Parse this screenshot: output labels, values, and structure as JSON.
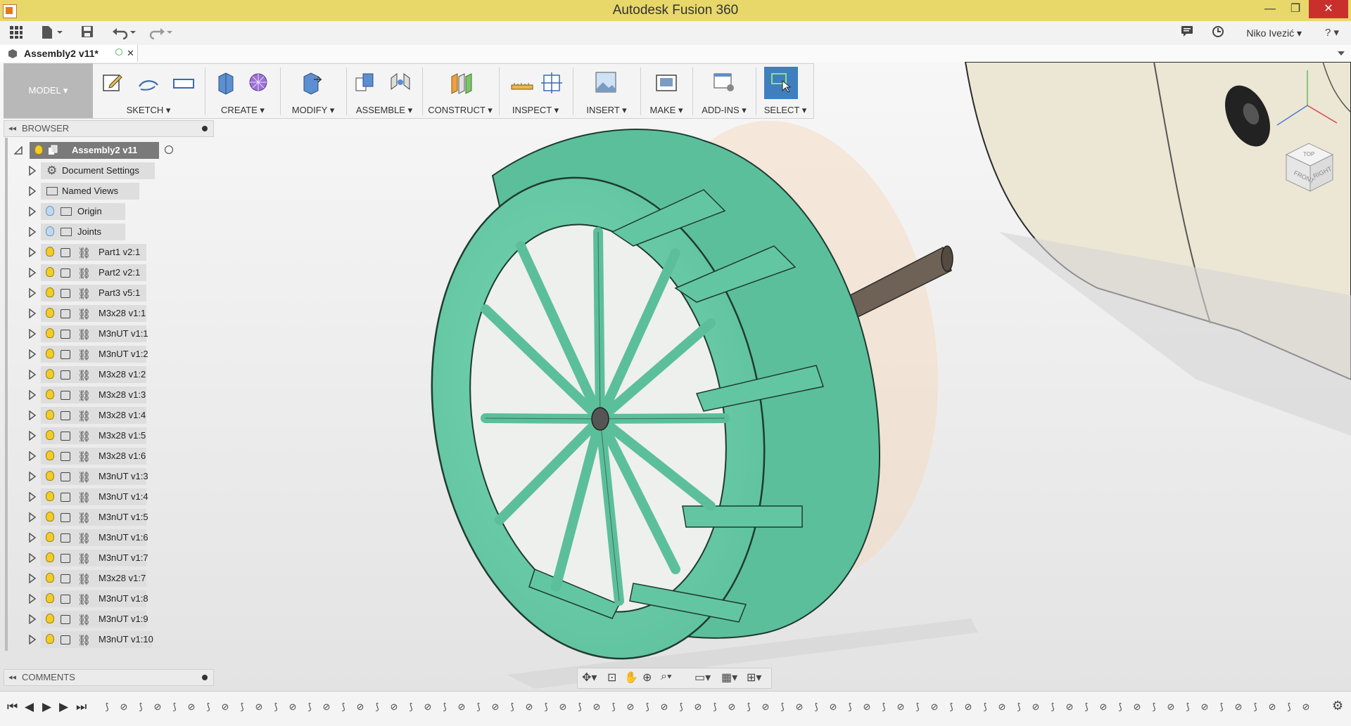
{
  "window": {
    "title": "Autodesk Fusion 360",
    "minimize": "—",
    "maximize": "❐",
    "close": "✕"
  },
  "quick_access": {
    "user": "Niko Ivezić ▾",
    "help": "? ▾"
  },
  "document_tab": {
    "label": "Assembly2 v11*",
    "close": "✕"
  },
  "toolbar": {
    "workspace": "MODEL ▾",
    "groups": [
      {
        "label": "SKETCH ▾"
      },
      {
        "label": "CREATE ▾"
      },
      {
        "label": "MODIFY ▾"
      },
      {
        "label": "ASSEMBLE ▾"
      },
      {
        "label": "CONSTRUCT ▾"
      },
      {
        "label": "INSPECT ▾"
      },
      {
        "label": "INSERT ▾"
      },
      {
        "label": "MAKE ▾"
      },
      {
        "label": "ADD-INS ▾"
      },
      {
        "label": "SELECT ▾"
      }
    ]
  },
  "browser": {
    "title": "BROWSER",
    "root": "Assembly2 v11",
    "items": [
      {
        "label": "Document Settings",
        "kind": "settings"
      },
      {
        "label": "Named Views",
        "kind": "folder"
      },
      {
        "label": "Origin",
        "kind": "folder-bulb"
      },
      {
        "label": "Joints",
        "kind": "folder-bulb"
      },
      {
        "label": "Part1 v2:1",
        "kind": "component"
      },
      {
        "label": "Part2 v2:1",
        "kind": "component"
      },
      {
        "label": "Part3 v5:1",
        "kind": "component"
      },
      {
        "label": "M3x28 v1:1",
        "kind": "component"
      },
      {
        "label": "M3nUT v1:1",
        "kind": "component"
      },
      {
        "label": "M3nUT v1:2",
        "kind": "component"
      },
      {
        "label": "M3x28 v1:2",
        "kind": "component"
      },
      {
        "label": "M3x28 v1:3",
        "kind": "component"
      },
      {
        "label": "M3x28 v1:4",
        "kind": "component"
      },
      {
        "label": "M3x28 v1:5",
        "kind": "component"
      },
      {
        "label": "M3x28 v1:6",
        "kind": "component"
      },
      {
        "label": "M3nUT v1:3",
        "kind": "component"
      },
      {
        "label": "M3nUT v1:4",
        "kind": "component"
      },
      {
        "label": "M3nUT v1:5",
        "kind": "component"
      },
      {
        "label": "M3nUT v1:6",
        "kind": "component"
      },
      {
        "label": "M3nUT v1:7",
        "kind": "component"
      },
      {
        "label": "M3x28 v1:7",
        "kind": "component"
      },
      {
        "label": "M3nUT v1:8",
        "kind": "component"
      },
      {
        "label": "M3nUT v1:9",
        "kind": "component"
      },
      {
        "label": "M3nUT v1:10",
        "kind": "component"
      }
    ]
  },
  "comments": {
    "title": "COMMENTS"
  },
  "viewcube": {
    "faces": [
      "FRONT",
      "RIGHT",
      "TOP"
    ]
  },
  "colors": {
    "wheel": "#6fcfab",
    "titlebar": "#e8d86a",
    "select_active": "#3f7fbf"
  }
}
